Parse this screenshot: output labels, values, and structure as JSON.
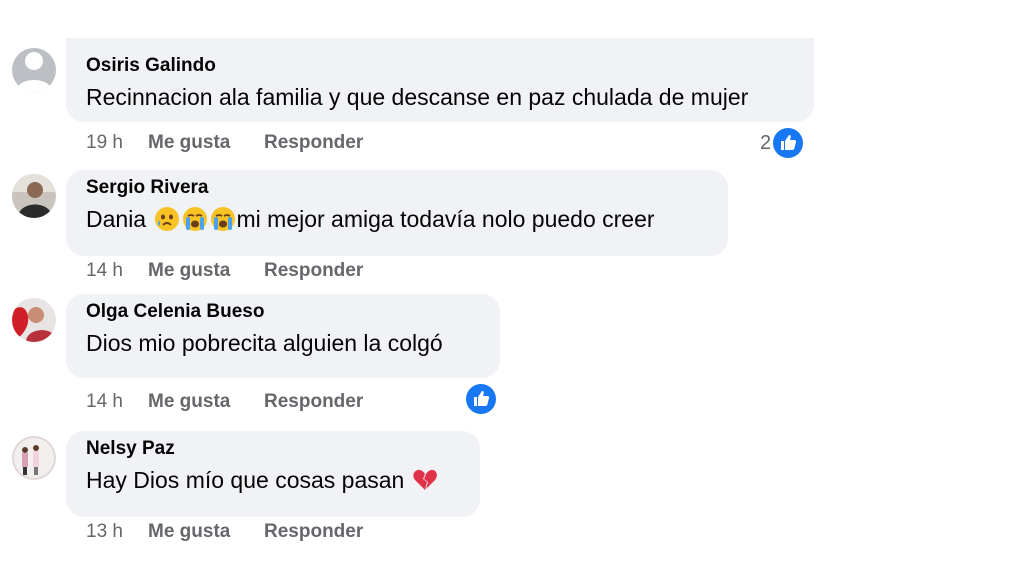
{
  "comments": [
    {
      "author": "Osiris Galindo",
      "text": "Recinnacion ala familia y que descanse en paz chulada de mujer",
      "time": "19 h",
      "like_label": "Me gusta",
      "reply_label": "Responder",
      "reaction_count": "2",
      "reaction_icon": "like-icon"
    },
    {
      "author": "Sergio Rivera",
      "text_prefix": "Dania",
      "text_suffix": "mi mejor amiga todavía nolo puedo creer",
      "emojis": [
        "crying-face-icon",
        "loudly-crying-face-icon",
        "loudly-crying-face-icon"
      ],
      "time": "14 h",
      "like_label": "Me gusta",
      "reply_label": "Responder"
    },
    {
      "author": "Olga Celenia Bueso",
      "text": "Dios mio pobrecita alguien la colgó",
      "time": "14 h",
      "like_label": "Me gusta",
      "reply_label": "Responder",
      "reaction_icon": "like-icon"
    },
    {
      "author": "Nelsy Paz",
      "text": "Hay Dios mío que cosas pasan",
      "emojis": [
        "broken-heart-icon"
      ],
      "time": "13 h",
      "like_label": "Me gusta",
      "reply_label": "Responder"
    }
  ],
  "colors": {
    "bubble": "#f0f2f5",
    "secondary_text": "#65676b",
    "like_blue": "#1877f2"
  }
}
